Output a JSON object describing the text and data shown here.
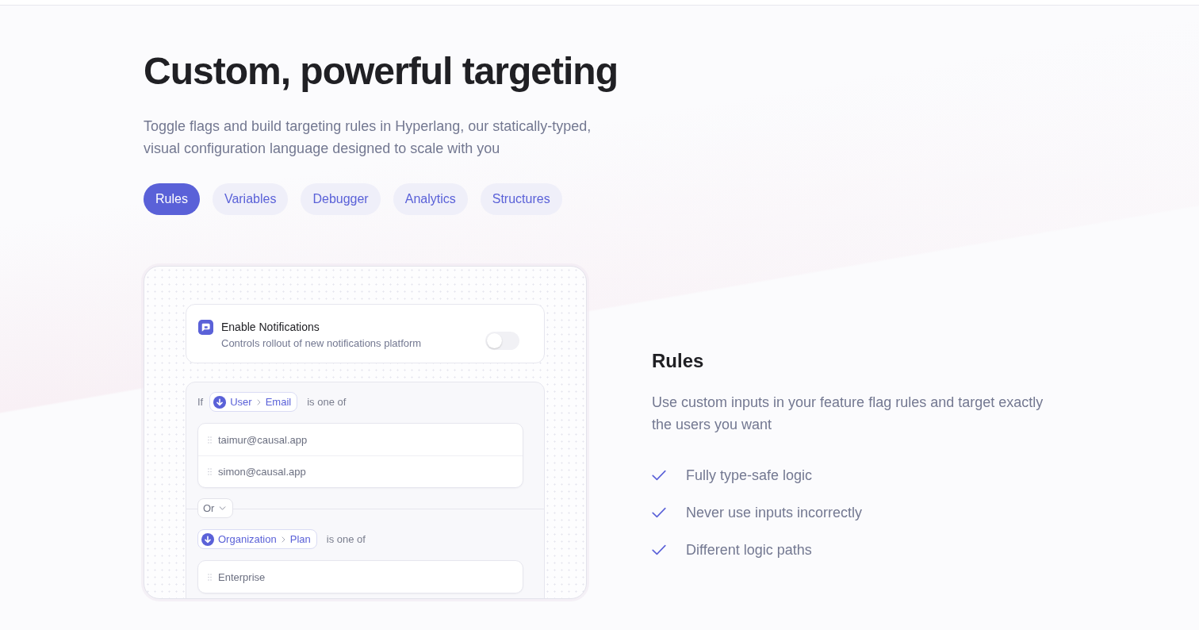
{
  "header": {
    "title": "Custom, powerful targeting",
    "subtitle": "Toggle flags and build targeting rules in Hyperlang, our statically-typed, visual configuration language designed to scale with you"
  },
  "tabs": [
    {
      "label": "Rules",
      "selected": true
    },
    {
      "label": "Variables",
      "selected": false
    },
    {
      "label": "Debugger",
      "selected": false
    },
    {
      "label": "Analytics",
      "selected": false
    },
    {
      "label": "Structures",
      "selected": false
    }
  ],
  "preview": {
    "flag": {
      "name": "Enable Notifications",
      "description": "Controls rollout of new notifications platform",
      "on": false
    },
    "conditions": [
      {
        "prefix": "If",
        "attribute": [
          "User",
          "Email"
        ],
        "operator": "is one of",
        "values": [
          "taimur@causal.app",
          "simon@causal.app"
        ]
      },
      {
        "combinator": "Or",
        "attribute": [
          "Organization",
          "Plan"
        ],
        "operator": "is one of",
        "values": [
          "Enterprise"
        ]
      }
    ]
  },
  "detail": {
    "title": "Rules",
    "description": "Use custom inputs in your feature flag rules and target exactly the users you want",
    "features": [
      "Fully type-safe logic",
      "Never use inputs incorrectly",
      "Different logic paths"
    ]
  }
}
